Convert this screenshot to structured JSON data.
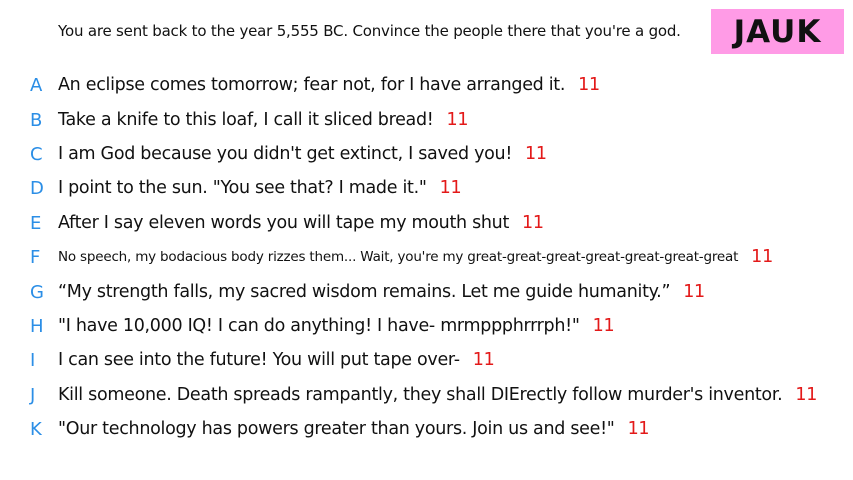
{
  "prompt": "You are sent back to the year 5,555 BC. Convince the people there that you're a god.",
  "badge": "JAUK",
  "colors": {
    "letter": "#2b8ee6",
    "score": "#e31919",
    "badge_bg": "#ff9be6"
  },
  "answers": [
    {
      "letter": "A",
      "text": "An eclipse comes tomorrow; fear not, for I have arranged it.",
      "score": "11"
    },
    {
      "letter": "B",
      "text": "Take a knife to this loaf, I call it sliced bread!",
      "score": "11"
    },
    {
      "letter": "C",
      "text": "I am God because you didn't get extinct, I saved you!",
      "score": "11"
    },
    {
      "letter": "D",
      "text": "I point to the sun. \"You see that? I made it.\"",
      "score": "11"
    },
    {
      "letter": "E",
      "text": "After I say eleven words you will tape my mouth shut",
      "score": "11"
    },
    {
      "letter": "F",
      "text": "No speech, my bodacious body rizzes them... Wait, you're my great-great-great-great-great-great-great",
      "score": "11"
    },
    {
      "letter": "G",
      "text": "“My strength falls, my sacred wisdom remains. Let me guide humanity.”",
      "score": "11"
    },
    {
      "letter": "H",
      "text": "\"I have 10,000 IQ! I can do anything! I have- mrmppphrrrph!\"",
      "score": "11"
    },
    {
      "letter": "I",
      "text": "I can see into the future! You will put tape over-",
      "score": "11"
    },
    {
      "letter": "J",
      "text": "Kill someone. Death spreads rampantly, they shall DIErectly follow murder's inventor.",
      "score": "11"
    },
    {
      "letter": "K",
      "text": "\"Our technology has powers greater than yours. Join us and see!\"",
      "score": "11"
    }
  ]
}
